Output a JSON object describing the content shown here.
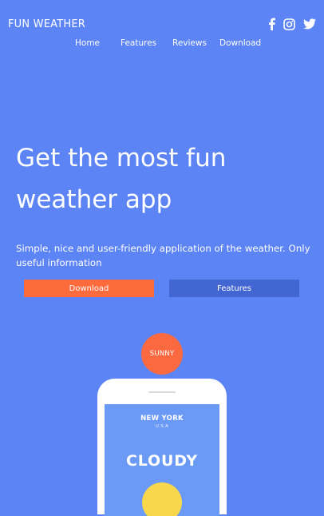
{
  "header": {
    "brand": "FUN WEATHER",
    "social": [
      {
        "icon": "facebook-icon"
      },
      {
        "icon": "instagram-icon"
      },
      {
        "icon": "twitter-icon"
      }
    ]
  },
  "nav": {
    "items": [
      "Home",
      "Features",
      "Reviews",
      "Download"
    ]
  },
  "hero": {
    "title": "Get the most fun weather app",
    "subtitle": "Simple, nice and user-friendly application of the weather. Only useful information",
    "download_label": "Download",
    "features_label": "Features"
  },
  "badge": {
    "label": "SUNNY"
  },
  "phone": {
    "city": "NEW YORK",
    "country": "U.S.A",
    "condition": "CLOUDY"
  },
  "colors": {
    "background": "#5c84f4",
    "download_button": "#fd6a3c",
    "features_button": "#4266d2",
    "badge": "#fa6940",
    "phone_screen": "#6b9af6",
    "sun": "#f7d84d"
  }
}
